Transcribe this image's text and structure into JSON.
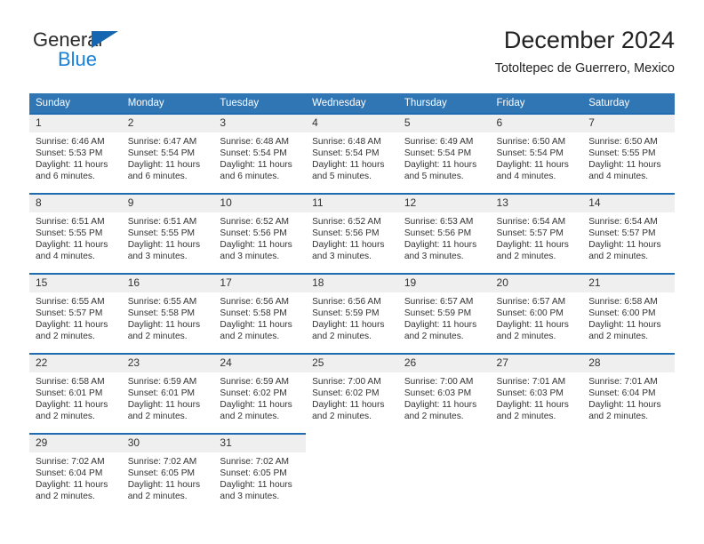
{
  "brand": {
    "name_top": "General",
    "name_bottom": "Blue",
    "triangle_color": "#1566b0",
    "blue_color": "#1a81d6"
  },
  "header": {
    "title": "December 2024",
    "subtitle": "Totoltepec de Guerrero, Mexico"
  },
  "theme": {
    "header_bg": "#3075b4",
    "cell_border": "#1f6cb0",
    "date_band_bg": "#efefef",
    "text": "#333333"
  },
  "weekday_headers": [
    "Sunday",
    "Monday",
    "Tuesday",
    "Wednesday",
    "Thursday",
    "Friday",
    "Saturday"
  ],
  "weeks": [
    [
      {
        "date": "1",
        "sunrise": "Sunrise: 6:46 AM",
        "sunset": "Sunset: 5:53 PM",
        "daylight1": "Daylight: 11 hours",
        "daylight2": "and 6 minutes."
      },
      {
        "date": "2",
        "sunrise": "Sunrise: 6:47 AM",
        "sunset": "Sunset: 5:54 PM",
        "daylight1": "Daylight: 11 hours",
        "daylight2": "and 6 minutes."
      },
      {
        "date": "3",
        "sunrise": "Sunrise: 6:48 AM",
        "sunset": "Sunset: 5:54 PM",
        "daylight1": "Daylight: 11 hours",
        "daylight2": "and 6 minutes."
      },
      {
        "date": "4",
        "sunrise": "Sunrise: 6:48 AM",
        "sunset": "Sunset: 5:54 PM",
        "daylight1": "Daylight: 11 hours",
        "daylight2": "and 5 minutes."
      },
      {
        "date": "5",
        "sunrise": "Sunrise: 6:49 AM",
        "sunset": "Sunset: 5:54 PM",
        "daylight1": "Daylight: 11 hours",
        "daylight2": "and 5 minutes."
      },
      {
        "date": "6",
        "sunrise": "Sunrise: 6:50 AM",
        "sunset": "Sunset: 5:54 PM",
        "daylight1": "Daylight: 11 hours",
        "daylight2": "and 4 minutes."
      },
      {
        "date": "7",
        "sunrise": "Sunrise: 6:50 AM",
        "sunset": "Sunset: 5:55 PM",
        "daylight1": "Daylight: 11 hours",
        "daylight2": "and 4 minutes."
      }
    ],
    [
      {
        "date": "8",
        "sunrise": "Sunrise: 6:51 AM",
        "sunset": "Sunset: 5:55 PM",
        "daylight1": "Daylight: 11 hours",
        "daylight2": "and 4 minutes."
      },
      {
        "date": "9",
        "sunrise": "Sunrise: 6:51 AM",
        "sunset": "Sunset: 5:55 PM",
        "daylight1": "Daylight: 11 hours",
        "daylight2": "and 3 minutes."
      },
      {
        "date": "10",
        "sunrise": "Sunrise: 6:52 AM",
        "sunset": "Sunset: 5:56 PM",
        "daylight1": "Daylight: 11 hours",
        "daylight2": "and 3 minutes."
      },
      {
        "date": "11",
        "sunrise": "Sunrise: 6:52 AM",
        "sunset": "Sunset: 5:56 PM",
        "daylight1": "Daylight: 11 hours",
        "daylight2": "and 3 minutes."
      },
      {
        "date": "12",
        "sunrise": "Sunrise: 6:53 AM",
        "sunset": "Sunset: 5:56 PM",
        "daylight1": "Daylight: 11 hours",
        "daylight2": "and 3 minutes."
      },
      {
        "date": "13",
        "sunrise": "Sunrise: 6:54 AM",
        "sunset": "Sunset: 5:57 PM",
        "daylight1": "Daylight: 11 hours",
        "daylight2": "and 2 minutes."
      },
      {
        "date": "14",
        "sunrise": "Sunrise: 6:54 AM",
        "sunset": "Sunset: 5:57 PM",
        "daylight1": "Daylight: 11 hours",
        "daylight2": "and 2 minutes."
      }
    ],
    [
      {
        "date": "15",
        "sunrise": "Sunrise: 6:55 AM",
        "sunset": "Sunset: 5:57 PM",
        "daylight1": "Daylight: 11 hours",
        "daylight2": "and 2 minutes."
      },
      {
        "date": "16",
        "sunrise": "Sunrise: 6:55 AM",
        "sunset": "Sunset: 5:58 PM",
        "daylight1": "Daylight: 11 hours",
        "daylight2": "and 2 minutes."
      },
      {
        "date": "17",
        "sunrise": "Sunrise: 6:56 AM",
        "sunset": "Sunset: 5:58 PM",
        "daylight1": "Daylight: 11 hours",
        "daylight2": "and 2 minutes."
      },
      {
        "date": "18",
        "sunrise": "Sunrise: 6:56 AM",
        "sunset": "Sunset: 5:59 PM",
        "daylight1": "Daylight: 11 hours",
        "daylight2": "and 2 minutes."
      },
      {
        "date": "19",
        "sunrise": "Sunrise: 6:57 AM",
        "sunset": "Sunset: 5:59 PM",
        "daylight1": "Daylight: 11 hours",
        "daylight2": "and 2 minutes."
      },
      {
        "date": "20",
        "sunrise": "Sunrise: 6:57 AM",
        "sunset": "Sunset: 6:00 PM",
        "daylight1": "Daylight: 11 hours",
        "daylight2": "and 2 minutes."
      },
      {
        "date": "21",
        "sunrise": "Sunrise: 6:58 AM",
        "sunset": "Sunset: 6:00 PM",
        "daylight1": "Daylight: 11 hours",
        "daylight2": "and 2 minutes."
      }
    ],
    [
      {
        "date": "22",
        "sunrise": "Sunrise: 6:58 AM",
        "sunset": "Sunset: 6:01 PM",
        "daylight1": "Daylight: 11 hours",
        "daylight2": "and 2 minutes."
      },
      {
        "date": "23",
        "sunrise": "Sunrise: 6:59 AM",
        "sunset": "Sunset: 6:01 PM",
        "daylight1": "Daylight: 11 hours",
        "daylight2": "and 2 minutes."
      },
      {
        "date": "24",
        "sunrise": "Sunrise: 6:59 AM",
        "sunset": "Sunset: 6:02 PM",
        "daylight1": "Daylight: 11 hours",
        "daylight2": "and 2 minutes."
      },
      {
        "date": "25",
        "sunrise": "Sunrise: 7:00 AM",
        "sunset": "Sunset: 6:02 PM",
        "daylight1": "Daylight: 11 hours",
        "daylight2": "and 2 minutes."
      },
      {
        "date": "26",
        "sunrise": "Sunrise: 7:00 AM",
        "sunset": "Sunset: 6:03 PM",
        "daylight1": "Daylight: 11 hours",
        "daylight2": "and 2 minutes."
      },
      {
        "date": "27",
        "sunrise": "Sunrise: 7:01 AM",
        "sunset": "Sunset: 6:03 PM",
        "daylight1": "Daylight: 11 hours",
        "daylight2": "and 2 minutes."
      },
      {
        "date": "28",
        "sunrise": "Sunrise: 7:01 AM",
        "sunset": "Sunset: 6:04 PM",
        "daylight1": "Daylight: 11 hours",
        "daylight2": "and 2 minutes."
      }
    ],
    [
      {
        "date": "29",
        "sunrise": "Sunrise: 7:02 AM",
        "sunset": "Sunset: 6:04 PM",
        "daylight1": "Daylight: 11 hours",
        "daylight2": "and 2 minutes."
      },
      {
        "date": "30",
        "sunrise": "Sunrise: 7:02 AM",
        "sunset": "Sunset: 6:05 PM",
        "daylight1": "Daylight: 11 hours",
        "daylight2": "and 2 minutes."
      },
      {
        "date": "31",
        "sunrise": "Sunrise: 7:02 AM",
        "sunset": "Sunset: 6:05 PM",
        "daylight1": "Daylight: 11 hours",
        "daylight2": "and 3 minutes."
      },
      {
        "date": "",
        "sunrise": "",
        "sunset": "",
        "daylight1": "",
        "daylight2": "",
        "blank": true
      },
      {
        "date": "",
        "sunrise": "",
        "sunset": "",
        "daylight1": "",
        "daylight2": "",
        "blank": true
      },
      {
        "date": "",
        "sunrise": "",
        "sunset": "",
        "daylight1": "",
        "daylight2": "",
        "blank": true
      },
      {
        "date": "",
        "sunrise": "",
        "sunset": "",
        "daylight1": "",
        "daylight2": "",
        "blank": true
      }
    ]
  ]
}
